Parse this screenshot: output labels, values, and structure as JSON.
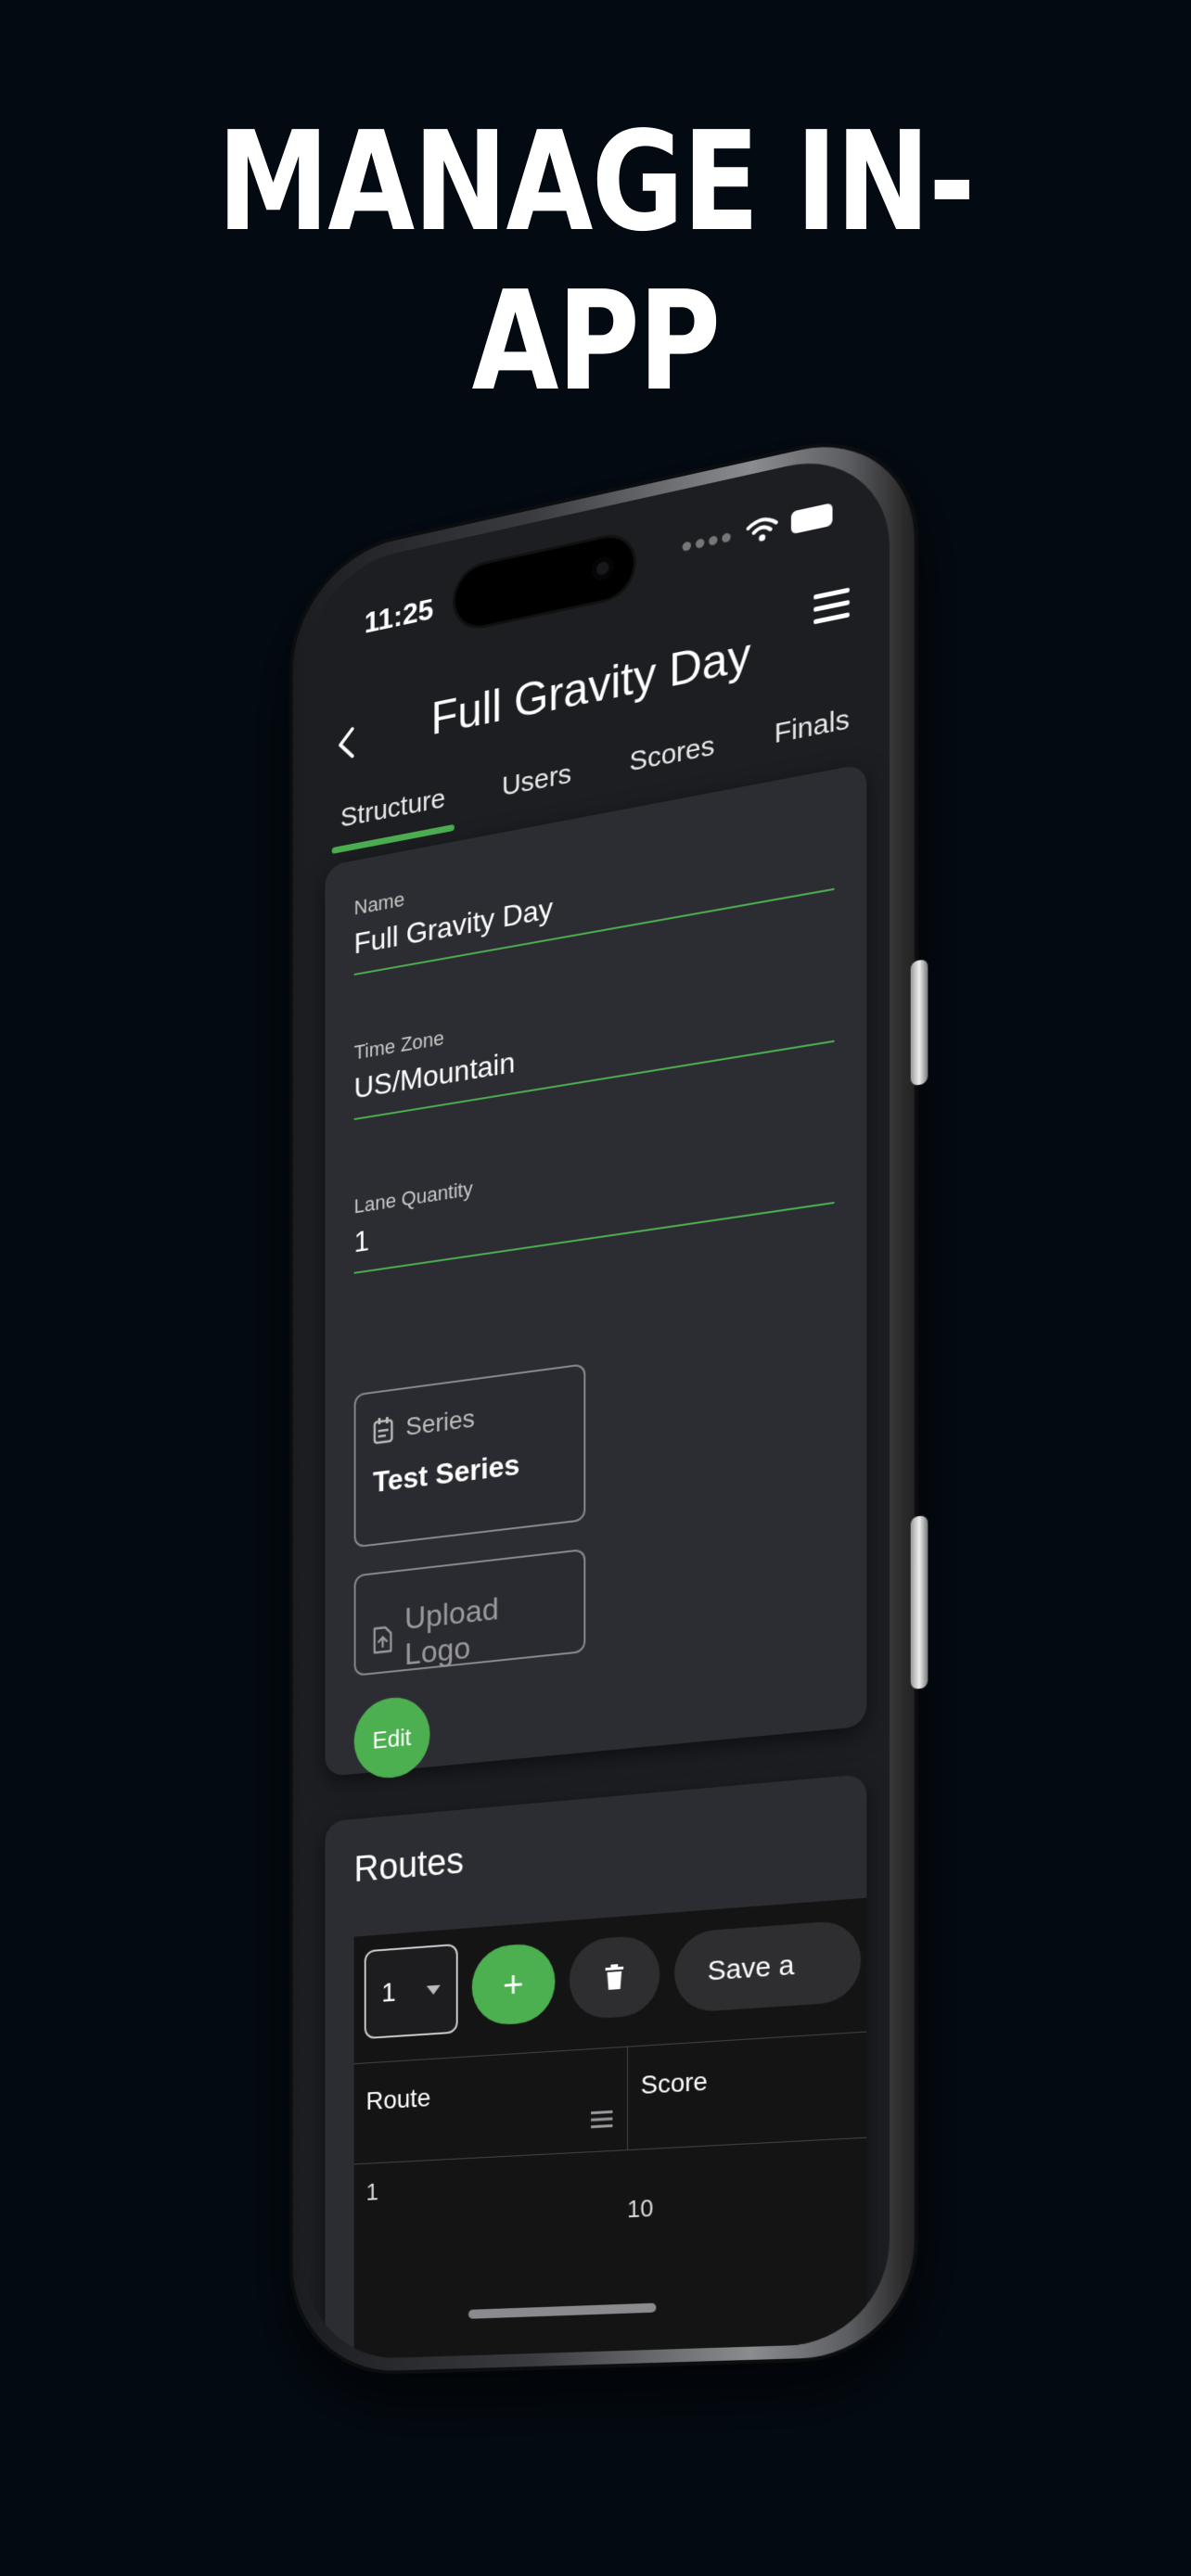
{
  "headline": "MANAGE IN-APP",
  "status": {
    "time": "11:25"
  },
  "header": {
    "title": "Full Gravity Day"
  },
  "tabs": [
    {
      "label": "Structure",
      "active": true
    },
    {
      "label": "Users",
      "active": false
    },
    {
      "label": "Scores",
      "active": false
    },
    {
      "label": "Finals",
      "active": false
    }
  ],
  "structure": {
    "fields": [
      {
        "label": "Name",
        "value": "Full Gravity Day"
      },
      {
        "label": "Time Zone",
        "value": "US/Mountain"
      },
      {
        "label": "Lane Quantity",
        "value": "1"
      }
    ],
    "series_chip": {
      "label": "Series",
      "value": "Test Series"
    },
    "upload_chip": {
      "label": "Upload Logo"
    },
    "edit_label": "Edit"
  },
  "routes": {
    "title": "Routes",
    "selected_route": "1",
    "add_label": "+",
    "save_label": "Save a",
    "columns": [
      "Route",
      "Score"
    ],
    "rows": [
      {
        "route": "1",
        "score": "10"
      }
    ]
  },
  "colors": {
    "accent": "#4caf50",
    "background": "#030a12",
    "card": "#2c2d32"
  }
}
